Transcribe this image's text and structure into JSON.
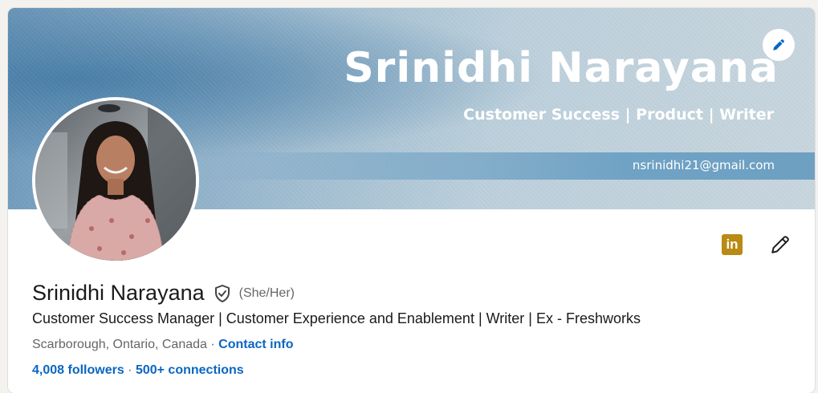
{
  "banner": {
    "name": "Srinidhi Narayana",
    "tagline": "Customer Success | Product | Writer",
    "email": "nsrinidhi21@gmail.com"
  },
  "profile": {
    "name": "Srinidhi Narayana",
    "pronouns": "(She/Her)",
    "headline": "Customer Success Manager | Customer Experience and Enablement | Writer | Ex - Freshworks",
    "location": "Scarborough, Ontario, Canada",
    "location_separator": " · ",
    "contact_info": "Contact info",
    "followers": "4,008 followers",
    "network_separator": " · ",
    "connections": "500+ connections"
  },
  "icons": {
    "banner_edit": "pencil-icon",
    "profile_edit": "pencil-icon",
    "linkedin": "linkedin-icon",
    "linkedin_glyph": "in",
    "verification": "shield-check-icon"
  },
  "colors": {
    "link": "#0a66c2",
    "linkedin_badge": "#b98a15"
  }
}
